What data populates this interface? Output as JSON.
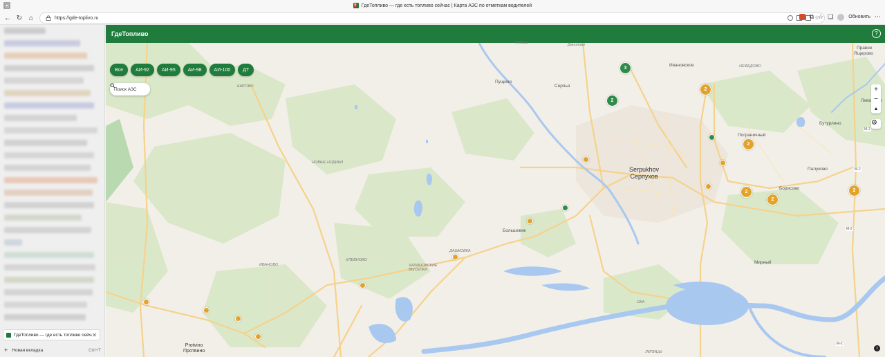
{
  "browser": {
    "title": "ГдеТопливо — где есть топливо сейчас | Карта АЗС по отметкам водителей",
    "url": "https://gde-toplivo.ru",
    "refresh_label": "Обновить"
  },
  "sidebar": {
    "active_tab_title": "ГдеТопливо — где есть топливо сейчас",
    "new_tab_label": "Новая вкладка",
    "new_tab_shortcut": "Ctrl+T"
  },
  "app": {
    "brand": "ГдеТопливо",
    "help": "?",
    "filters": [
      "Все",
      "АИ-92",
      "АИ-95",
      "АИ-98",
      "АИ-100",
      "ДТ"
    ],
    "search_placeholder": "Поиск АЗС",
    "zoom_in": "+",
    "zoom_out": "−",
    "info": "i"
  },
  "map": {
    "labels": {
      "glebovo": "Глебово",
      "danilovo": "Данилово",
      "pravoe": "Правое",
      "yashcherovo": "Ящерово",
      "ivanovskoe": "Ивановское",
      "nefedovo": "НЕФЕДОВО",
      "pushchino": "Пущино",
      "serpukhov_lat": "Serpukhov",
      "serpukhov_cyr": "Серпухов",
      "shatovo": "ШАТОВО",
      "novye_nodiki": "НОВЫЕ НОДИКИ",
      "pogranichny": "Пограничный",
      "butyrino": "Бутурлино",
      "palukovo": "Палуково",
      "borisovo": "Борисово",
      "bolshevik": "Большевик",
      "dashkovka": "ДАШКОВКА",
      "khlevnovo": "ХЛЕВНОВО",
      "khalinovskie": "ХАЛИНОВСКИЕ ВЫСЕЛКИ",
      "ivanovo": "ИВАНОВО",
      "mirny": "Мирный",
      "protvino_lat": "Protvino",
      "protvino_cyr": "Протвино",
      "m2": "M-2",
      "levashovo": "Левашово",
      "serpy": "Серпья",
      "oka": "ОКА",
      "lipitsy": "ЛИПИЦЫ"
    },
    "clusters": [
      {
        "count": "3",
        "color": "green"
      },
      {
        "count": "2",
        "color": "green"
      },
      {
        "count": "2",
        "color": "yellow"
      },
      {
        "count": "2",
        "color": "yellow"
      },
      {
        "count": "2",
        "color": "yellow"
      },
      {
        "count": "2",
        "color": "yellow"
      },
      {
        "count": "2",
        "color": "yellow"
      }
    ]
  },
  "colors": {
    "brand_green": "#1f7c3c",
    "pin_yellow": "#e2a32b",
    "pin_green": "#2e8b4a",
    "water": "#a9c8f0"
  }
}
